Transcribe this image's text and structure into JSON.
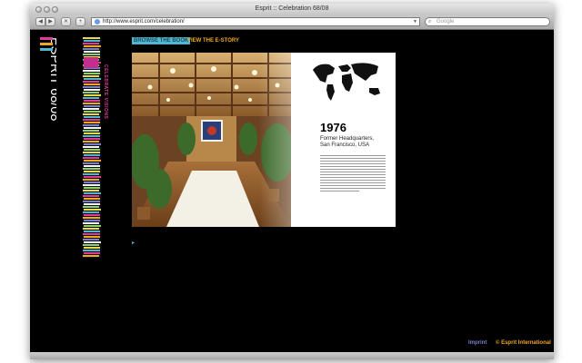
{
  "browser": {
    "window_title": "Esprit :: Celebration 68/08",
    "back_glyph": "◀",
    "forward_glyph": "▶",
    "stop_glyph": "✕",
    "add_glyph": "+",
    "url": "http://www.esprit.com/celebration/",
    "url_dropdown_glyph": "▼",
    "search_placeholder": "Google",
    "search_glyph": "⌕"
  },
  "site": {
    "logo_text": "ESPRIT 68/08",
    "side_tagline": "CELEBRATE VISIONS",
    "nav": {
      "browse_label": "BROWSE THE BOOK",
      "estory_label": "VIEW THE E-STORY"
    },
    "page": {
      "year": "1976",
      "caption_line1": "Former Headquarters,",
      "caption_line2": "San Francisco, USA"
    },
    "arrow_glyph": "▸",
    "footer": {
      "imprint_label": "Imprint",
      "copyright_label": "© Esprit International"
    }
  },
  "colors": {
    "accent_cyan": "#4fb7cf",
    "accent_orange": "#f0a81e",
    "accent_pink": "#e03b9c",
    "accent_purple": "#7a7fd0"
  }
}
